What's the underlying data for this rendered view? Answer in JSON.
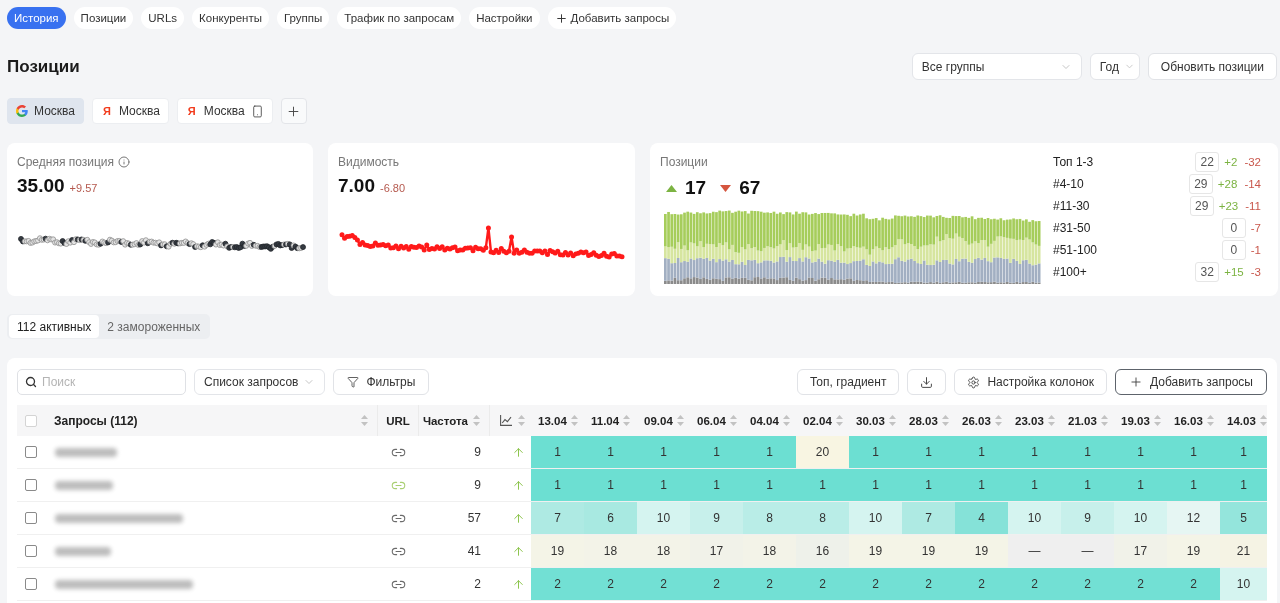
{
  "nav_tabs": [
    {
      "kind": "tab",
      "label": "История",
      "selected": true
    },
    {
      "kind": "tab",
      "label": "Позиции",
      "selected": false
    },
    {
      "kind": "tab",
      "label": "URLs",
      "selected": false
    },
    {
      "kind": "tab",
      "label": "Конкуренты",
      "selected": false
    },
    {
      "kind": "tab",
      "label": "Группы",
      "selected": false
    },
    {
      "kind": "tab",
      "label": "Трафик по запросам",
      "selected": false
    },
    {
      "kind": "tab",
      "label": "Настройки",
      "selected": false
    },
    {
      "kind": "add",
      "label": "Добавить запросы",
      "selected": false
    }
  ],
  "page_title": "Позиции",
  "filters": {
    "group_select": "Все группы",
    "period_select": "Год",
    "refresh_button": "Обновить позиции"
  },
  "engine_tabs": [
    {
      "kind": "google",
      "label": "Москва",
      "selected": true,
      "mobile": false
    },
    {
      "kind": "yandex",
      "logo": "Я",
      "label": "Москва",
      "selected": false,
      "mobile": false
    },
    {
      "kind": "yandex",
      "logo": "Я",
      "label": "Москва",
      "selected": false,
      "mobile": true
    }
  ],
  "metrics": [
    {
      "kind": "dots",
      "title": "Средняя позиция",
      "info_icon": true,
      "value": "35.00",
      "delta": "+9.57",
      "delta_good": false
    },
    {
      "kind": "line",
      "title": "Видимость",
      "info_icon": false,
      "value": "7.00",
      "delta": "-6.80",
      "delta_good": false
    }
  ],
  "positions": {
    "title": "Позиции",
    "up": "17",
    "down": "67",
    "ranges": [
      {
        "label": "Топ 1-3",
        "count": "22",
        "gain": "+2",
        "loss": "-32"
      },
      {
        "label": "#4-10",
        "count": "29",
        "gain": "+28",
        "loss": "-14"
      },
      {
        "label": "#11-30",
        "count": "29",
        "gain": "+23",
        "loss": "-11"
      },
      {
        "label": "#31-50",
        "count": "0",
        "loss": "-7"
      },
      {
        "label": "#51-100",
        "count": "0",
        "loss": "-1"
      },
      {
        "label": "#100+",
        "count": "32",
        "gain": "+15",
        "loss": "-3"
      }
    ]
  },
  "status_tabs": [
    {
      "label": "112 активных",
      "selected": true
    },
    {
      "label": "2 замороженных",
      "selected": false
    }
  ],
  "toolbar": {
    "search_placeholder": "Поиск",
    "list_select": "Список запросов",
    "filters_button": "Фильтры",
    "view_button": "Топ, градиент",
    "columns_button": "Настройка колонок",
    "add_button": "Добавить запросы"
  },
  "table": {
    "select_all_checked": false,
    "columns": {
      "query": "Запросы (112)",
      "url": "URL",
      "frequency": "Частота",
      "dates": [
        "13.04",
        "11.04",
        "09.04",
        "06.04",
        "04.04",
        "02.04",
        "30.03",
        "28.03",
        "26.03",
        "23.03",
        "21.03",
        "19.03",
        "16.03",
        "14.03"
      ]
    },
    "rows": [
      {
        "checked": false,
        "url_match": false,
        "frequency": "9",
        "improved": true,
        "cells": [
          {
            "text": "1",
            "color": "#6cdfd2"
          },
          {
            "text": "1",
            "color": "#6cdfd2"
          },
          {
            "text": "1",
            "color": "#6cdfd2"
          },
          {
            "text": "1",
            "color": "#6cdfd2"
          },
          {
            "text": "1",
            "color": "#6cdfd2"
          },
          {
            "text": "20",
            "color": "#f8f5e2"
          },
          {
            "text": "1",
            "color": "#6cdfd2"
          },
          {
            "text": "1",
            "color": "#6cdfd2"
          },
          {
            "text": "1",
            "color": "#6cdfd2"
          },
          {
            "text": "1",
            "color": "#6cdfd2"
          },
          {
            "text": "1",
            "color": "#6cdfd2"
          },
          {
            "text": "1",
            "color": "#6cdfd2"
          },
          {
            "text": "1",
            "color": "#6cdfd2"
          },
          {
            "text": "1",
            "color": "#6cdfd2"
          }
        ]
      },
      {
        "checked": false,
        "url_match": true,
        "frequency": "9",
        "improved": true,
        "cells": [
          {
            "text": "1",
            "color": "#6cdfd2"
          },
          {
            "text": "1",
            "color": "#6cdfd2"
          },
          {
            "text": "1",
            "color": "#6cdfd2"
          },
          {
            "text": "1",
            "color": "#6cdfd2"
          },
          {
            "text": "1",
            "color": "#6cdfd2"
          },
          {
            "text": "1",
            "color": "#6cdfd2"
          },
          {
            "text": "1",
            "color": "#6cdfd2"
          },
          {
            "text": "1",
            "color": "#6cdfd2"
          },
          {
            "text": "1",
            "color": "#6cdfd2"
          },
          {
            "text": "1",
            "color": "#6cdfd2"
          },
          {
            "text": "1",
            "color": "#6cdfd2"
          },
          {
            "text": "1",
            "color": "#6cdfd2"
          },
          {
            "text": "1",
            "color": "#6cdfd2"
          },
          {
            "text": "1",
            "color": "#6cdfd2"
          }
        ]
      },
      {
        "checked": false,
        "url_match": false,
        "frequency": "57",
        "improved": true,
        "cells": [
          {
            "text": "7",
            "color": "#aeeae3"
          },
          {
            "text": "6",
            "color": "#a8e9e1"
          },
          {
            "text": "10",
            "color": "#d5f4f0"
          },
          {
            "text": "9",
            "color": "#c7f0eb"
          },
          {
            "text": "8",
            "color": "#b9ede7"
          },
          {
            "text": "8",
            "color": "#b9ede7"
          },
          {
            "text": "10",
            "color": "#d5f4f0"
          },
          {
            "text": "7",
            "color": "#aeeae3"
          },
          {
            "text": "4",
            "color": "#85e2d8"
          },
          {
            "text": "10",
            "color": "#d5f4f0"
          },
          {
            "text": "9",
            "color": "#c7f0eb"
          },
          {
            "text": "10",
            "color": "#d5f4f0"
          },
          {
            "text": "12",
            "color": "#e6f6f3"
          },
          {
            "text": "5",
            "color": "#94e5dc"
          }
        ]
      },
      {
        "checked": false,
        "url_match": false,
        "frequency": "41",
        "improved": true,
        "cells": [
          {
            "text": "19",
            "color": "#f4f4e7"
          },
          {
            "text": "18",
            "color": "#f3f3e8"
          },
          {
            "text": "18",
            "color": "#f3f3e8"
          },
          {
            "text": "17",
            "color": "#f1f2e9"
          },
          {
            "text": "18",
            "color": "#f3f3e8"
          },
          {
            "text": "16",
            "color": "#eef1ea"
          },
          {
            "text": "19",
            "color": "#f4f4e7"
          },
          {
            "text": "19",
            "color": "#f4f4e7"
          },
          {
            "text": "19",
            "color": "#f4f4e7"
          },
          {
            "text": "—",
            "color": "#efefef"
          },
          {
            "text": "—",
            "color": "#efefef"
          },
          {
            "text": "17",
            "color": "#f1f2e9"
          },
          {
            "text": "19",
            "color": "#f4f4e7"
          },
          {
            "text": "21",
            "color": "#f5f3e4"
          }
        ]
      },
      {
        "checked": false,
        "url_match": false,
        "frequency": "2",
        "improved": true,
        "cells": [
          {
            "text": "2",
            "color": "#72e0d4"
          },
          {
            "text": "2",
            "color": "#72e0d4"
          },
          {
            "text": "2",
            "color": "#72e0d4"
          },
          {
            "text": "2",
            "color": "#72e0d4"
          },
          {
            "text": "2",
            "color": "#72e0d4"
          },
          {
            "text": "2",
            "color": "#72e0d4"
          },
          {
            "text": "2",
            "color": "#72e0d4"
          },
          {
            "text": "2",
            "color": "#72e0d4"
          },
          {
            "text": "2",
            "color": "#72e0d4"
          },
          {
            "text": "2",
            "color": "#72e0d4"
          },
          {
            "text": "2",
            "color": "#72e0d4"
          },
          {
            "text": "2",
            "color": "#72e0d4"
          },
          {
            "text": "2",
            "color": "#72e0d4"
          },
          {
            "text": "10",
            "color": "#d5f4f0"
          }
        ]
      }
    ]
  }
}
